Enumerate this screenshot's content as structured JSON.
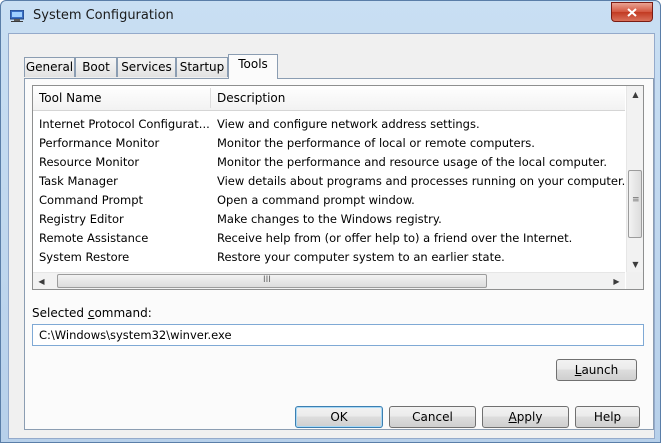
{
  "window": {
    "title": "System Configuration",
    "icon": "msconfig-icon"
  },
  "tabs": [
    {
      "label": "General",
      "active": false
    },
    {
      "label": "Boot",
      "active": false
    },
    {
      "label": "Services",
      "active": false
    },
    {
      "label": "Startup",
      "active": false
    },
    {
      "label": "Tools",
      "active": true
    }
  ],
  "tools_list": {
    "columns": [
      "Tool Name",
      "Description"
    ],
    "rows": [
      {
        "name": "Internet Protocol Configurat...",
        "description": "View and configure network address settings."
      },
      {
        "name": "Performance Monitor",
        "description": "Monitor the performance of local or remote computers."
      },
      {
        "name": "Resource Monitor",
        "description": "Monitor the performance and resource usage of the local computer."
      },
      {
        "name": "Task Manager",
        "description": "View details about programs and processes running on your computer."
      },
      {
        "name": "Command Prompt",
        "description": "Open a command prompt window."
      },
      {
        "name": "Registry Editor",
        "description": "Make changes to the Windows registry."
      },
      {
        "name": "Remote Assistance",
        "description": "Receive help from (or offer help to) a friend over the Internet."
      },
      {
        "name": "System Restore",
        "description": "Restore your computer system to an earlier state."
      }
    ]
  },
  "selected_command": {
    "label_pre": "Selected ",
    "label_access": "c",
    "label_post": "ommand:",
    "value": "C:\\Windows\\system32\\winver.exe"
  },
  "launch_button": {
    "access": "L",
    "rest": "aunch"
  },
  "footer": {
    "ok": "OK",
    "cancel": "Cancel",
    "apply_access": "A",
    "apply_rest": "pply",
    "help": "Help"
  }
}
